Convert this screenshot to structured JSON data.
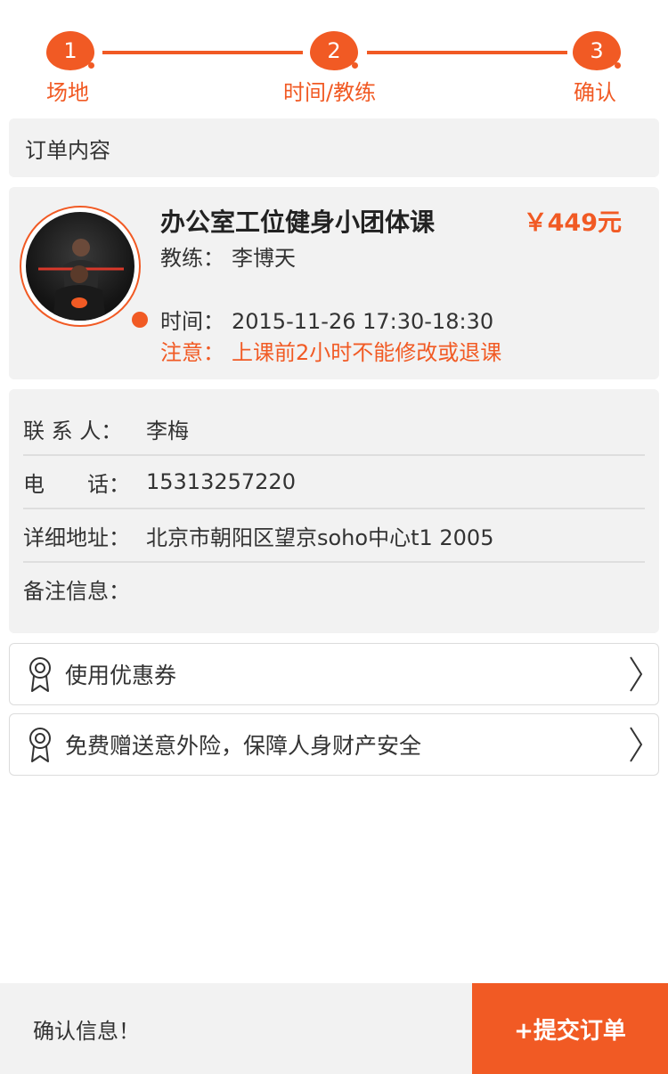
{
  "steps": [
    {
      "number": "1",
      "label": "场地"
    },
    {
      "number": "2",
      "label": "时间/教练"
    },
    {
      "number": "3",
      "label": "确认"
    }
  ],
  "colors": {
    "accent": "#f15a24",
    "panel": "#f2f2f2"
  },
  "order_section": {
    "title": "订单内容"
  },
  "order": {
    "course_title": "办公室工位健身小团体课",
    "price": "￥449元",
    "coach_label": "教练：",
    "coach_name": "李博天",
    "time_label": "时间：",
    "time_value": "2015-11-26 17:30-18:30",
    "notice_label": "注意：",
    "notice_value": "上课前2小时不能修改或退课"
  },
  "contact": {
    "contact_label": "联 系 人：",
    "contact_value": "李梅",
    "phone_label": "电　　话：",
    "phone_value": "15313257220",
    "address_label": "详细地址：",
    "address_value": "北京市朝阳区望京soho中心t1 2005",
    "remark_label": "备注信息：",
    "remark_value": ""
  },
  "options": [
    {
      "label": "使用优惠券",
      "icon": "award-ribbon-icon"
    },
    {
      "label": "免费赠送意外险，保障人身财产安全",
      "icon": "award-ribbon-icon"
    }
  ],
  "footer": {
    "info": "确认信息！",
    "submit": "+提交订单"
  }
}
